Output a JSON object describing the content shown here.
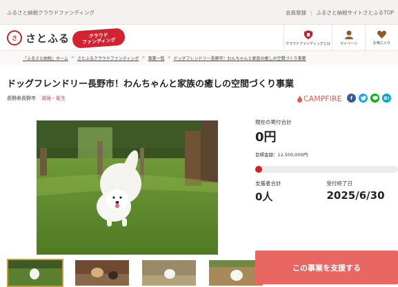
{
  "topbar": {
    "lead": "ふるさと納税クラウドファンディング",
    "links": [
      "会員登録",
      "ふるさと納税サイトさとふるTOP"
    ]
  },
  "header": {
    "logo_text": "さとふる",
    "badge_line1": "クラウド",
    "badge_line2": "ファンディング",
    "nav": [
      {
        "label": "クラウドファンディングとは",
        "icon": "shield-icon"
      },
      {
        "label": "マイページ",
        "icon": "user-icon"
      },
      {
        "label": "お気に入り",
        "icon": "heart-icon"
      }
    ]
  },
  "breadcrumb": [
    "「ふるさと納税」ホーム",
    "さとふるクラウドファンディング",
    "事業一覧",
    "ドッグフレンドリー長野市！わんちゃんと家族の癒しの空間づくり事業"
  ],
  "project": {
    "title": "ドッグフレンドリー長野市！わんちゃんと家族の癒しの空間づくり事業",
    "region": "長野県長野市",
    "category": "環境・衛生",
    "partner": "CAMPFIRE"
  },
  "funding": {
    "current_label": "現在の寄付合計",
    "current_amount": "0円",
    "goal_text": "目標金額：12,500,000円",
    "progress": 0,
    "supporters_label": "支援者合計",
    "supporters_value": "0人",
    "deadline_label": "受付終了日",
    "deadline_value": "2025/6/30",
    "support_button": "この事業を支援する"
  },
  "colors": {
    "brand": "#d32330",
    "button": "#e86763",
    "facebook": "#3b5998",
    "twitter": "#1da1f2",
    "line": "#00b900",
    "hatena": "#00a4de"
  }
}
